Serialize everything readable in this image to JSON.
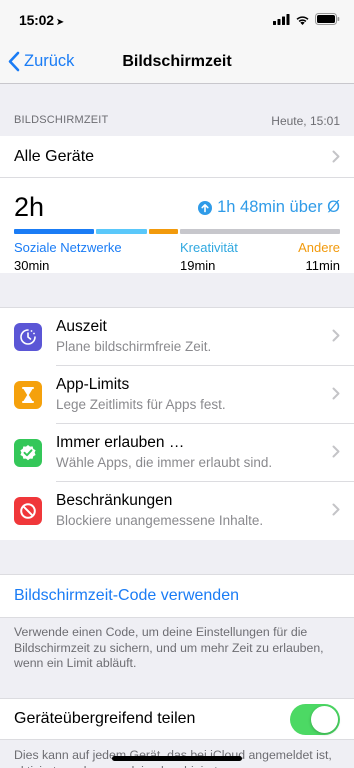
{
  "status_bar": {
    "time": "15:02",
    "location_glyph": "➤"
  },
  "nav": {
    "back_label": "Zurück",
    "title": "Bildschirmzeit"
  },
  "section": {
    "label": "BILDSCHIRMZEIT",
    "timestamp": "Heute, 15:01"
  },
  "all_devices": {
    "label": "Alle Geräte"
  },
  "usage": {
    "total": "2h",
    "diff": "1h 48min über Ø",
    "bar_fractions": {
      "social": 0.25,
      "creativity": 0.16,
      "other": 0.09,
      "remaining": 0.5
    },
    "categories": [
      {
        "name": "Soziale Netzwerke",
        "value": "30min"
      },
      {
        "name": "Kreativität",
        "value": "19min"
      },
      {
        "name": "Andere",
        "value": "11min"
      }
    ]
  },
  "items": [
    {
      "title": "Auszeit",
      "subtitle": "Plane bildschirmfreie Zeit.",
      "icon": "moon-clock-icon",
      "color": "#5b56d6"
    },
    {
      "title": "App-Limits",
      "subtitle": "Lege Zeitlimits für Apps fest.",
      "icon": "hourglass-icon",
      "color": "#f5a10c"
    },
    {
      "title": "Immer erlauben …",
      "subtitle": "Wähle Apps, die immer erlaubt sind.",
      "icon": "checkmark-badge-icon",
      "color": "#34c759"
    },
    {
      "title": "Beschränkungen",
      "subtitle": "Blockiere unangemessene Inhalte.",
      "icon": "no-entry-icon",
      "color": "#f0373a"
    }
  ],
  "passcode": {
    "link": "Bildschirmzeit-Code verwenden",
    "footer": "Verwende einen Code, um deine Einstellungen für die Bildschirmzeit zu sichern, und um mehr Zeit zu erlauben, wenn ein Limit abläuft."
  },
  "share": {
    "label": "Geräteübergreifend teilen",
    "enabled": true,
    "footer": "Dies kann auf jedem Gerät, das bei iCloud angemeldet ist, aktiviert werden, um deine kombinierte"
  },
  "colors": {
    "accent": "#1a7cf5",
    "social": "#1a7cf5",
    "creativity": "#5ac8fa",
    "other": "#f29a0c",
    "switch_on": "#4cd964"
  }
}
